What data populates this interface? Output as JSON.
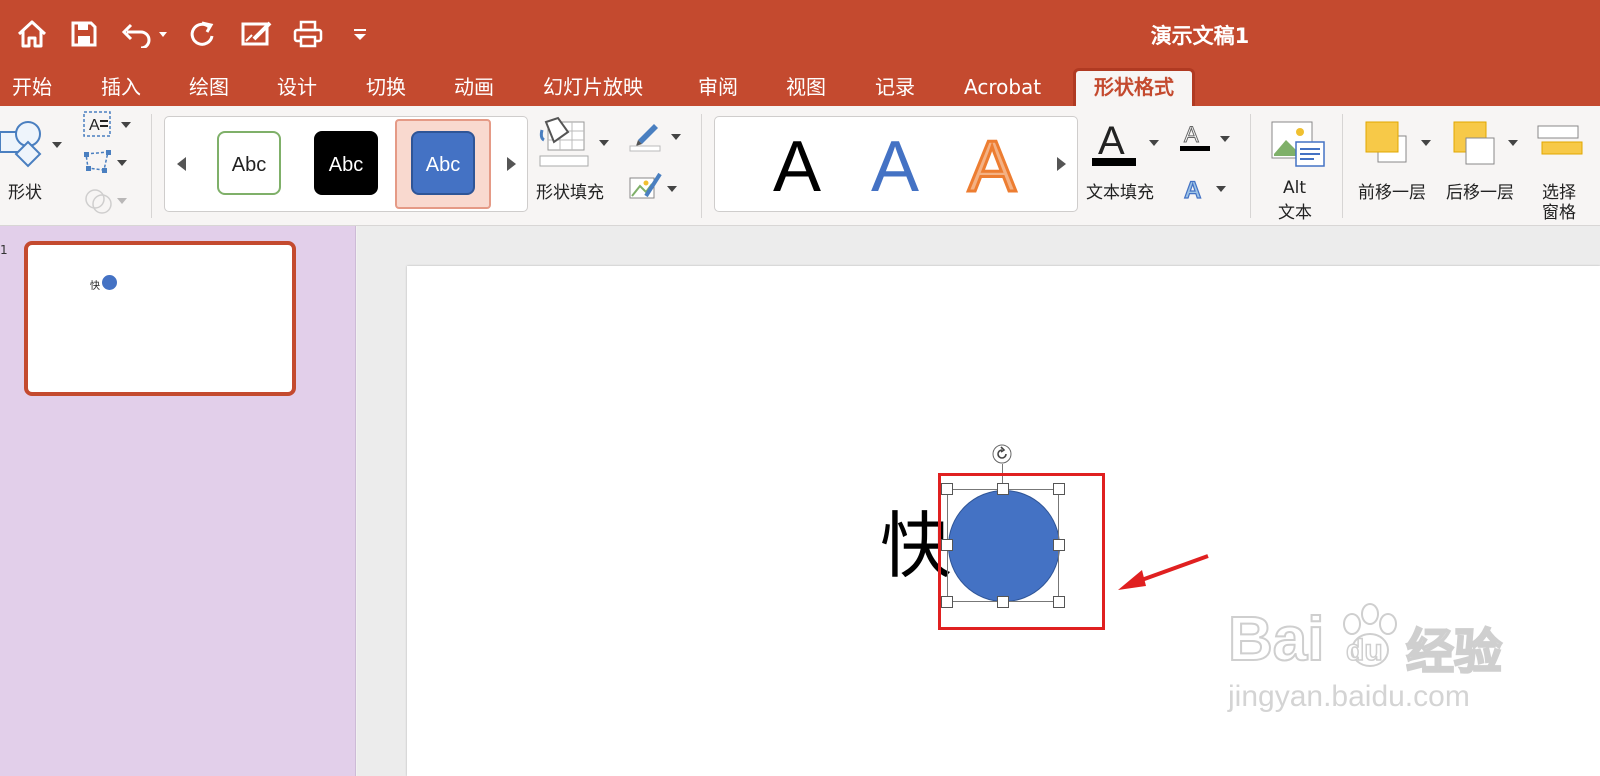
{
  "window": {
    "title": "演示文稿1"
  },
  "quick_access": {
    "icons": [
      "home-icon",
      "save-icon",
      "undo-icon",
      "redo-icon",
      "edit-doc-icon",
      "print-icon",
      "customize-icon"
    ]
  },
  "tabs": [
    {
      "label": "开始",
      "active": false
    },
    {
      "label": "插入",
      "active": false
    },
    {
      "label": "绘图",
      "active": false
    },
    {
      "label": "设计",
      "active": false
    },
    {
      "label": "切换",
      "active": false
    },
    {
      "label": "动画",
      "active": false
    },
    {
      "label": "幻灯片放映",
      "active": false
    },
    {
      "label": "审阅",
      "active": false
    },
    {
      "label": "视图",
      "active": false
    },
    {
      "label": "记录",
      "active": false
    },
    {
      "label": "Acrobat",
      "active": false
    },
    {
      "label": "形状格式",
      "active": true
    }
  ],
  "ribbon": {
    "shapes_label": "形状",
    "shape_styles": [
      {
        "label": "Abc",
        "fill": "#ffffff",
        "border": "#7fb069",
        "text": "#222222",
        "selected": false
      },
      {
        "label": "Abc",
        "fill": "#000000",
        "border": "#000000",
        "text": "#ffffff",
        "selected": false
      },
      {
        "label": "Abc",
        "fill": "#4472c4",
        "border": "#2f5597",
        "text": "#ffffff",
        "selected": true
      }
    ],
    "shape_fill_label": "形状填充",
    "wordart": [
      {
        "letter": "A",
        "color": "#000000"
      },
      {
        "letter": "A",
        "color": "#4472c4"
      },
      {
        "letter": "A",
        "color": "#f4b183"
      }
    ],
    "text_fill_label": "文本填充",
    "alt_text_label_1": "Alt",
    "alt_text_label_2": "文本",
    "bring_forward_label": "前移一层",
    "send_backward_label": "后移一层",
    "selection_pane_label_1": "选择",
    "selection_pane_label_2": "窗格"
  },
  "thumbnail": {
    "slide_number": "1",
    "text": "快"
  },
  "slide": {
    "text": "快",
    "circle_color": "#4472c4",
    "highlight_color": "#e02020",
    "arrow_color": "#e02020"
  },
  "watermark": {
    "brand": "Bai",
    "brand2": "du",
    "suffix": "经验",
    "url": "jingyan.baidu.com"
  },
  "colors": {
    "accent": "#c44a2f",
    "pane": "#e2cfea"
  }
}
